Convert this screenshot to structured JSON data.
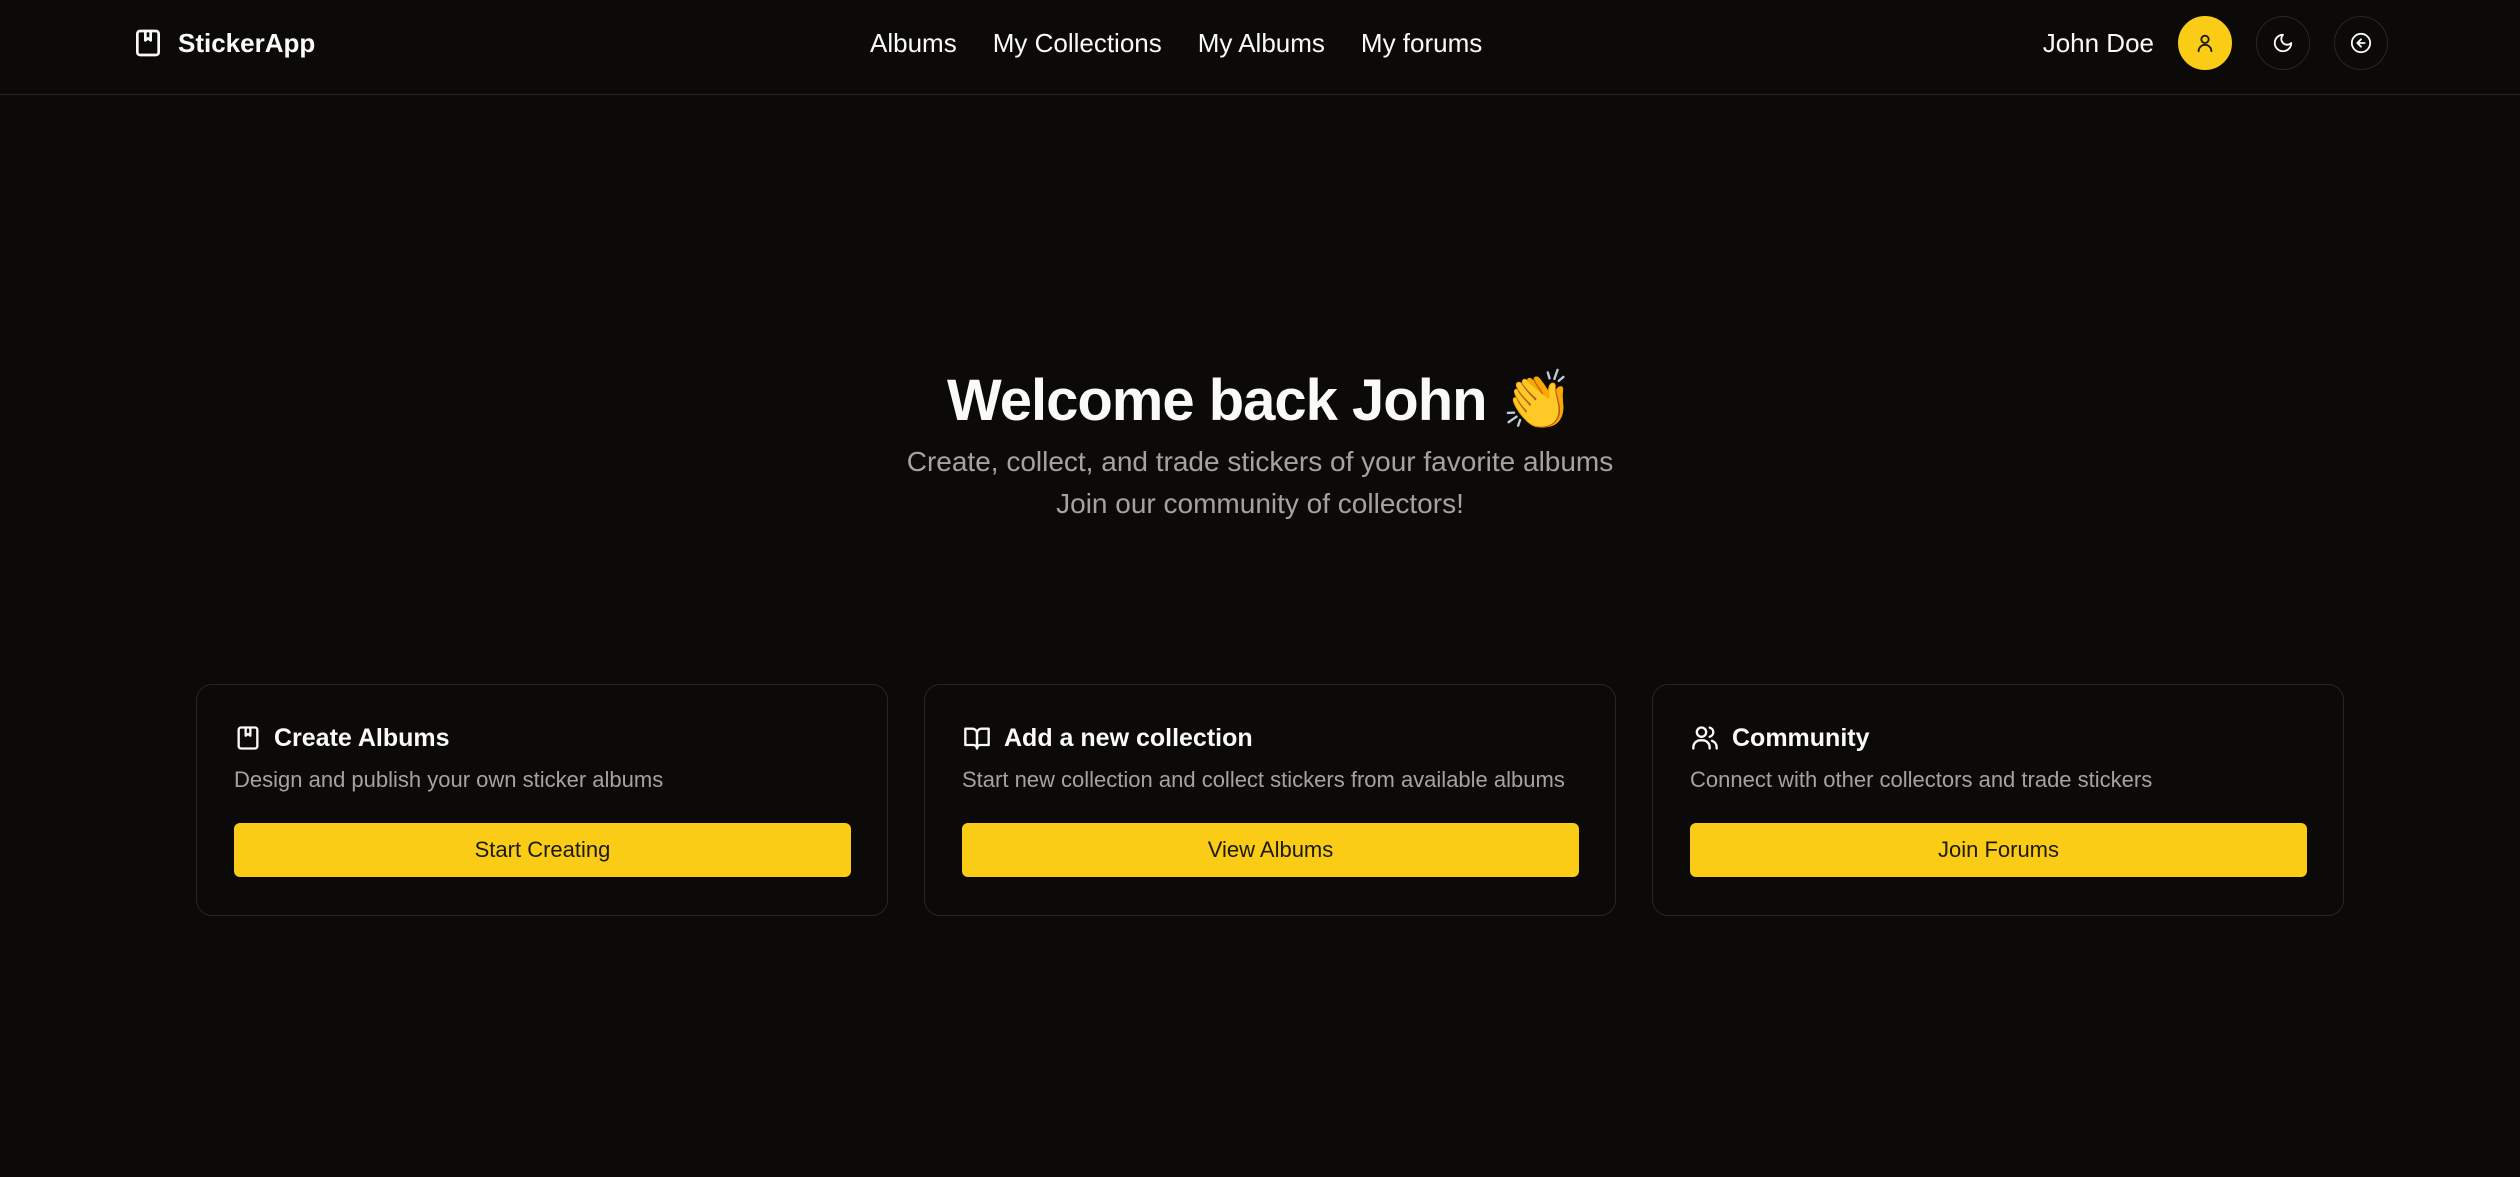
{
  "header": {
    "brand": "StickerApp",
    "brand_icon": "book-marked-icon",
    "nav": [
      {
        "label": "Albums"
      },
      {
        "label": "My Collections"
      },
      {
        "label": "My Albums"
      },
      {
        "label": "My forums"
      }
    ],
    "user_name": "John Doe",
    "avatar_icon": "user-icon",
    "theme_icon": "moon-icon",
    "logout_icon": "circle-arrow-left-icon"
  },
  "hero": {
    "title": "Welcome back John",
    "emoji": "👏",
    "subtitle_line1": "Create, collect, and trade stickers of your favorite albums",
    "subtitle_line2": "Join our community of collectors!"
  },
  "cards": [
    {
      "icon": "book-marked-icon",
      "title": "Create Albums",
      "description": "Design and publish your own sticker albums",
      "button": "Start Creating"
    },
    {
      "icon": "book-open-icon",
      "title": "Add a new collection",
      "description": "Start new collection and collect stickers from available albums",
      "button": "View Albums"
    },
    {
      "icon": "users-icon",
      "title": "Community",
      "description": "Connect with other collectors and trade stickers",
      "button": "Join Forums"
    }
  ],
  "colors": {
    "background": "#0c0a09",
    "accent": "#facc15",
    "text": "#fafaf9",
    "muted": "#a8a29e",
    "border": "#292524"
  }
}
